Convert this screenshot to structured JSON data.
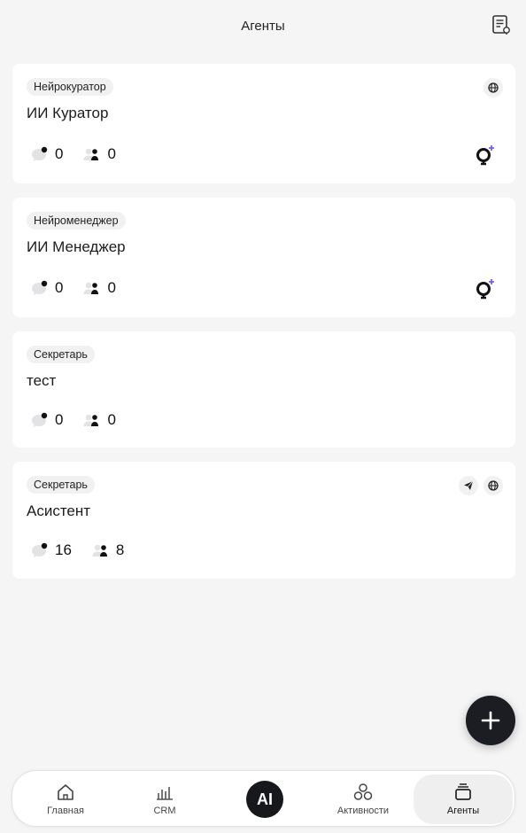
{
  "header": {
    "title": "Агенты",
    "action_icon": "notebook-icon"
  },
  "agents": [
    {
      "badge": "Нейрокуратор",
      "title": "ИИ Куратор",
      "chats": "0",
      "users": "0"
    },
    {
      "badge": "Нейроменеджер",
      "title": "ИИ Менеджер",
      "chats": "0",
      "users": "0"
    },
    {
      "badge": "Секретарь",
      "title": "тест",
      "chats": "0",
      "users": "0"
    },
    {
      "badge": "Секретарь",
      "title": "Асистент",
      "chats": "16",
      "users": "8"
    }
  ],
  "nav": {
    "home": "Главная",
    "crm": "CRM",
    "ai": "AI",
    "activities": "Активности",
    "agents": "Агенты"
  },
  "colors": {
    "accent": "#7a5cf0",
    "fab": "#1b1d22"
  }
}
